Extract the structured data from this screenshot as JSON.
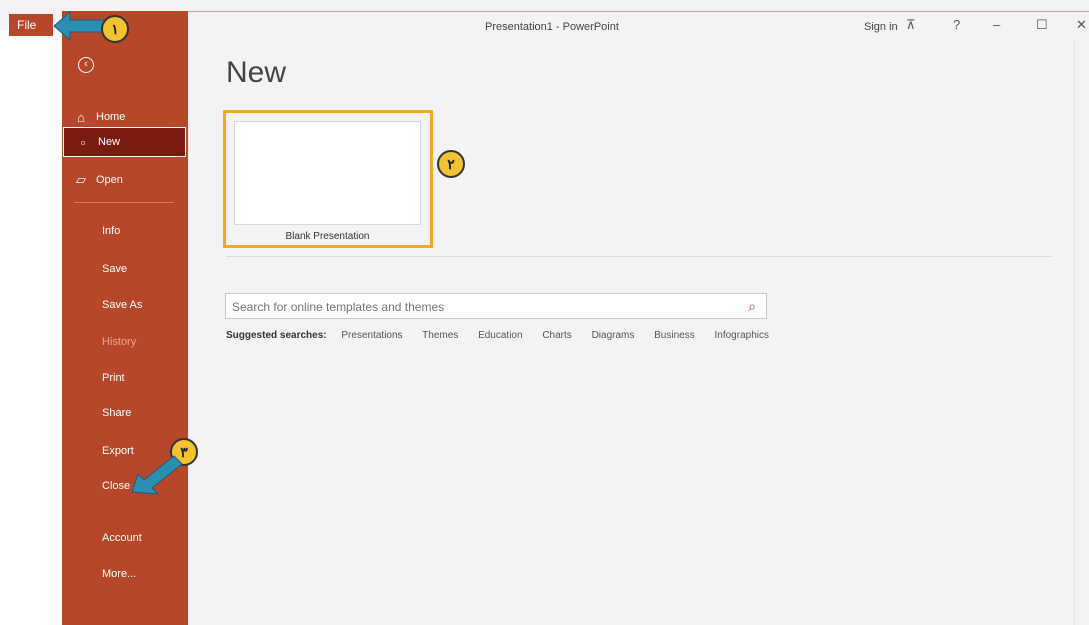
{
  "window": {
    "title": "Presentation1 - PowerPoint",
    "signin": "Sign in",
    "controls": [
      "minimize-icon",
      "restore-icon",
      "close-icon"
    ]
  },
  "file_tab": "File",
  "sidebar": {
    "items": [
      {
        "label": "Home",
        "icon": "home-icon"
      },
      {
        "label": "New",
        "icon": "new-document-icon",
        "active": true
      },
      {
        "label": "Open",
        "icon": "folder-open-icon"
      },
      {
        "label": "Info"
      },
      {
        "label": "Save"
      },
      {
        "label": "Save As"
      },
      {
        "label": "History",
        "disabled": true
      },
      {
        "label": "Print"
      },
      {
        "label": "Share"
      },
      {
        "label": "Export"
      },
      {
        "label": "Close"
      },
      {
        "label": "Account"
      },
      {
        "label": "More..."
      }
    ]
  },
  "main": {
    "title": "New",
    "blank_presentation": "Blank Presentation",
    "search": {
      "placeholder": "Search for online templates and themes"
    },
    "suggested_label": "Suggested searches:",
    "suggested": [
      "Presentations",
      "Themes",
      "Education",
      "Charts",
      "Diagrams",
      "Business",
      "Infographics"
    ]
  },
  "annotations": [
    {
      "label": "١"
    },
    {
      "label": "٢"
    },
    {
      "label": "٣"
    }
  ],
  "colors": {
    "accent": "#b7472a",
    "active": "#7a1b12",
    "highlight": "#f0a830",
    "badge": "#f2c230",
    "arrow": "#2b8fb3"
  }
}
